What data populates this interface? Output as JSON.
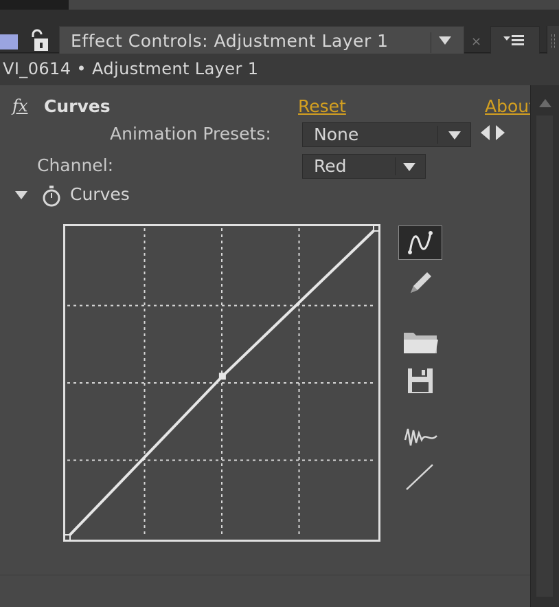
{
  "window": {
    "tab_title": "Effect Controls: Adjustment Layer 1",
    "tab_close": "×",
    "layer_path": "VI_0614 • Adjustment Layer 1"
  },
  "effect": {
    "fx_label": "fx",
    "name": "Curves",
    "reset_label": "Reset",
    "about_label": "About..."
  },
  "presets": {
    "label": "Animation Presets:",
    "value": "None"
  },
  "channel": {
    "label": "Channel:",
    "value": "Red"
  },
  "curves_section": {
    "title": "Curves"
  },
  "tools": [
    {
      "icon": "bezier-curve-icon",
      "active": true
    },
    {
      "icon": "pencil-icon",
      "active": false
    },
    {
      "icon": "open-folder-icon",
      "active": false
    },
    {
      "icon": "save-floppy-icon",
      "active": false
    },
    {
      "icon": "smooth-wave-icon",
      "active": false
    },
    {
      "icon": "reset-line-icon",
      "active": false
    }
  ],
  "curve": {
    "points": [
      [
        0,
        0
      ],
      [
        128,
        133
      ],
      [
        255,
        255
      ]
    ],
    "grid_divisions": 4
  },
  "colors": {
    "panel_bg": "#484848",
    "link": "#d4a020",
    "curve_line": "#e6e6e6"
  }
}
